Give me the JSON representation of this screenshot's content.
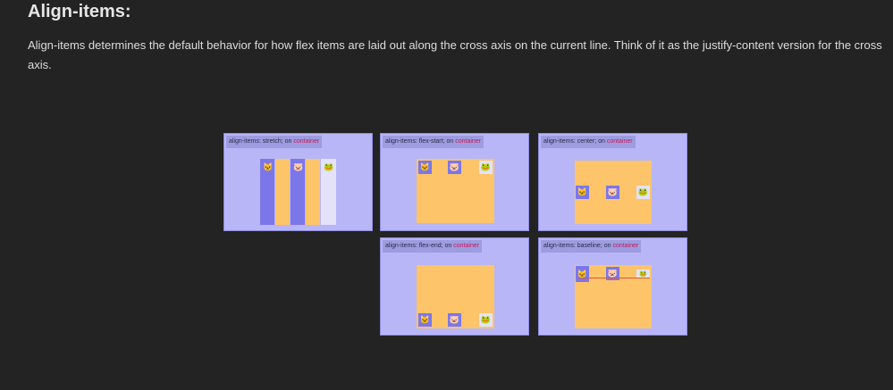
{
  "heading": "Align-items:",
  "paragraph": "Align-items determines the default behavior for how flex items are laid out along the cross axis on the current line. Think of it as the justify-content version for the cross axis.",
  "faint_labels": [
    "",
    ""
  ],
  "cards": [
    {
      "prefix": "align-items: stretch;",
      "on": " on ",
      "target": "container"
    },
    {
      "prefix": "align-items: flex-start;",
      "on": " on ",
      "target": "container"
    },
    {
      "prefix": "align-items: center;",
      "on": " on ",
      "target": "container"
    },
    {
      "prefix": "align-items: flex-end;",
      "on": " on ",
      "target": "container"
    },
    {
      "prefix": "align-items: baseline;",
      "on": " on ",
      "target": "container"
    }
  ],
  "item_icons": [
    "🐱",
    "🐷",
    "🐸"
  ],
  "colors": {
    "background": "#232323",
    "card": "#b8b6f6",
    "container": "#fdc46a",
    "item_purple": "#7b77e9",
    "item_light": "#e3e2fa",
    "keyword": "#c2185b"
  }
}
